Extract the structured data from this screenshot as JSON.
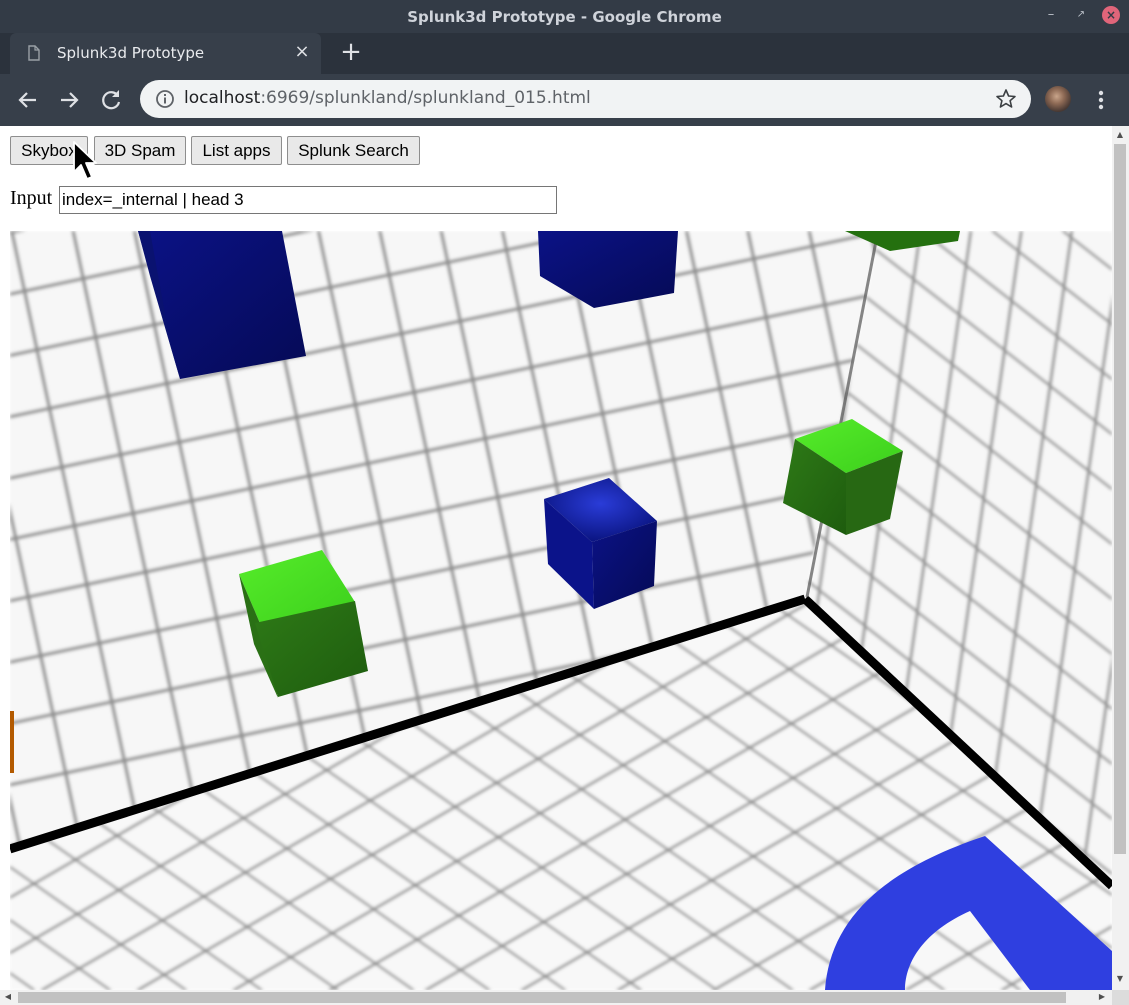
{
  "window": {
    "title": "Splunk3d Prototype - Google Chrome"
  },
  "tab": {
    "title": "Splunk3d Prototype"
  },
  "address_bar": {
    "url_host": "localhost",
    "url_rest": ":6969/splunkland/splunkland_015.html"
  },
  "page": {
    "buttons": {
      "skybox": "Skybox",
      "spam": "3D Spam",
      "list_apps": "List apps",
      "splunk_search": "Splunk Search"
    },
    "input_label": "Input",
    "input_value": "index=_internal | head 3"
  },
  "icons": [
    "page-favicon-icon",
    "close-icon",
    "plus-icon",
    "back-icon",
    "forward-icon",
    "reload-icon",
    "info-icon",
    "star-icon",
    "menu-icon",
    "mouse-cursor-icon"
  ],
  "colors": {
    "titlebar": "#333b46",
    "toolbar": "#373f4a",
    "cube_blue": "#0c1690",
    "cube_green": "#3fd41e",
    "floor_logo": "#2b3fe0"
  }
}
